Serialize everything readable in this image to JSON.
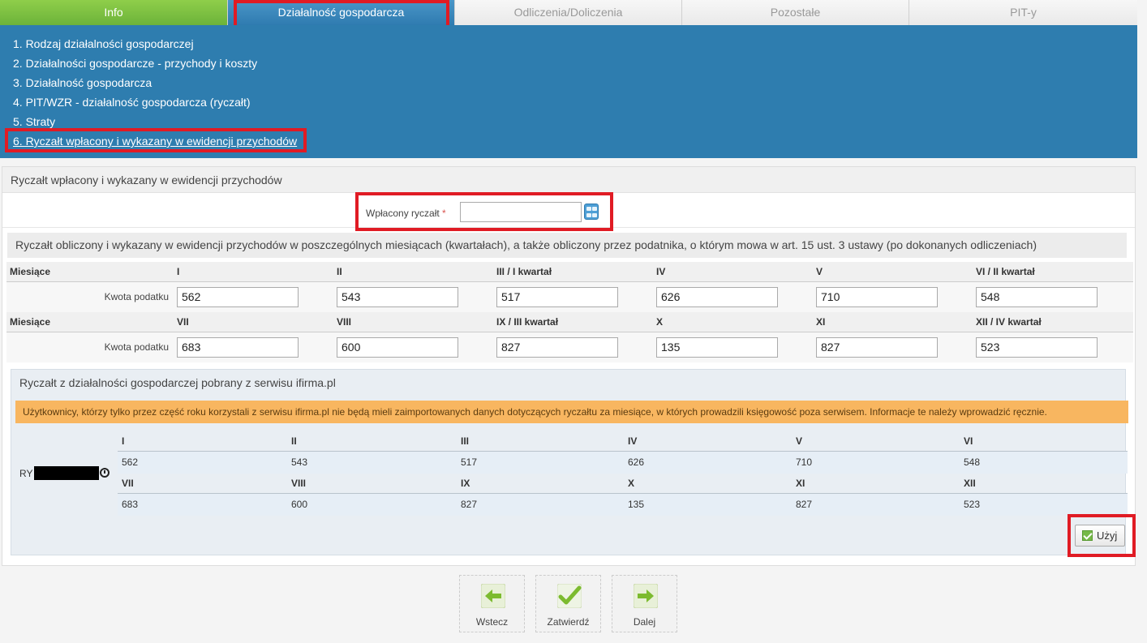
{
  "tabs": [
    "Info",
    "Działalność gospodarcza",
    "Odliczenia/Doliczenia",
    "Pozostałe",
    "PIT-y"
  ],
  "nav": [
    "1. Rodzaj działalności gospodarczej",
    "2. Działalności gospodarcze - przychody i koszty",
    "3. Działalność gospodarcza",
    "4. PIT/WZR - działalność gospodarcza (ryczałt)",
    "5. Straty",
    "6. Ryczałt wpłacony i wykazany w ewidencji przychodów"
  ],
  "panel": {
    "title": "Ryczałt wpłacony i wykazany w ewidencji przychodów",
    "paid_label": "Wpłacony ryczałt",
    "paid_required": "*",
    "paid_value": "",
    "section_title": "Ryczałt obliczony i wykazany w ewidencji przychodów w poszczególnych miesiącach (kwartałach), a także obliczony przez podatnika, o którym mowa w art. 15 ust. 3 ustawy (po dokonanych odliczeniach)"
  },
  "grid": {
    "month_label": "Miesiące",
    "amount_label": "Kwota podatku",
    "row1_months": [
      "I",
      "II",
      "III / I kwartał",
      "IV",
      "V",
      "VI / II kwartał"
    ],
    "row1_values": [
      "562",
      "543",
      "517",
      "626",
      "710",
      "548"
    ],
    "row2_months": [
      "VII",
      "VIII",
      "IX / III kwartał",
      "X",
      "XI",
      "XII / IV kwartał"
    ],
    "row2_values": [
      "683",
      "600",
      "827",
      "135",
      "827",
      "523"
    ]
  },
  "ifirma": {
    "title": "Ryczałt z działalności gospodarczej pobrany z serwisu ifirma.pl",
    "warning": "Użytkownicy, którzy tylko przez część roku korzystali z serwisu ifirma.pl nie będą mieli zaimportowanych danych dotyczących ryczałtu za miesiące, w których prowadzili księgowość poza serwisem. Informacje te należy wprowadzić ręcznie.",
    "ry_label": "RY",
    "row1_months": [
      "I",
      "II",
      "III",
      "IV",
      "V",
      "VI"
    ],
    "row1_values": [
      "562",
      "543",
      "517",
      "626",
      "710",
      "548"
    ],
    "row2_months": [
      "VII",
      "VIII",
      "IX",
      "X",
      "XI",
      "XII"
    ],
    "row2_values": [
      "683",
      "600",
      "827",
      "135",
      "827",
      "523"
    ],
    "use_button": "Użyj"
  },
  "buttons": {
    "back": "Wstecz",
    "confirm": "Zatwierdź",
    "next": "Dalej"
  },
  "colors": {
    "highlight": "#e01b24",
    "nav_bg": "#2e7daf",
    "info_tab": "#6cb33a",
    "warning_bg": "#f8b660"
  }
}
